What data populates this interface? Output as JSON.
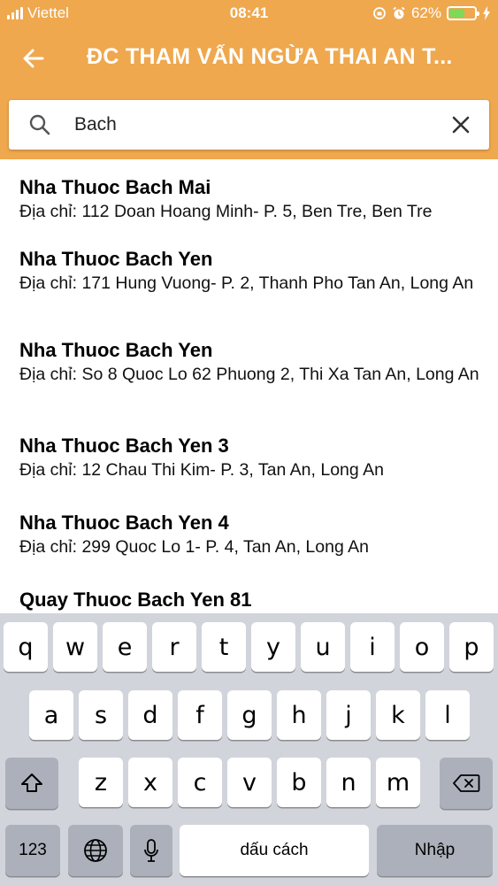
{
  "status_bar": {
    "carrier": "Viettel",
    "time": "08:41",
    "battery_percent": "62%",
    "battery_level": 0.62
  },
  "app_bar": {
    "title": "ĐC THAM VẤN NGỪA THAI AN T...",
    "back_icon": "arrow-left-icon"
  },
  "search": {
    "value": "Bach",
    "icon": "search-icon",
    "clear_icon": "close-icon"
  },
  "results": [
    {
      "name": "Nha Thuoc Bach Mai",
      "address": "Địa chỉ: 112 Doan Hoang Minh- P. 5, Ben Tre, Ben Tre"
    },
    {
      "name": "Nha Thuoc Bach Yen",
      "address": "Địa chỉ: 171 Hung Vuong- P. 2, Thanh Pho Tan An, Long An"
    },
    {
      "name": "Nha Thuoc Bach Yen",
      "address": "Địa chỉ: So 8 Quoc Lo 62 Phuong 2, Thi Xa Tan An, Long An"
    },
    {
      "name": "Nha Thuoc Bach Yen 3",
      "address": "Địa chỉ: 12 Chau Thi Kim- P. 3, Tan An, Long An"
    },
    {
      "name": "Nha Thuoc Bach Yen 4",
      "address": "Địa chỉ: 299 Quoc Lo 1- P. 4, Tan An, Long An"
    },
    {
      "name": "Quay Thuoc Bach Yen 81",
      "address": ""
    }
  ],
  "keyboard": {
    "row1": [
      "q",
      "w",
      "e",
      "r",
      "t",
      "y",
      "u",
      "i",
      "o",
      "p"
    ],
    "row2": [
      "a",
      "s",
      "d",
      "f",
      "g",
      "h",
      "j",
      "k",
      "l"
    ],
    "row3": [
      "z",
      "x",
      "c",
      "v",
      "b",
      "n",
      "m"
    ],
    "numbers_label": "123",
    "space_label": "dấu cách",
    "return_label": "Nhập"
  },
  "colors": {
    "app_bar": "#efa84e",
    "keyboard_bg": "#d1d4db"
  }
}
